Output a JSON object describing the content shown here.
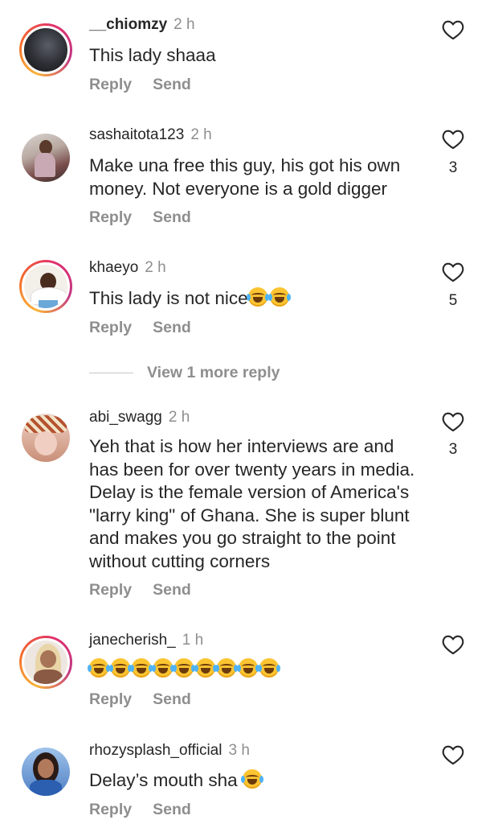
{
  "comments": [
    {
      "username": "__chiomzy",
      "time": "2 h",
      "text": "This lady shaaa",
      "likes": "",
      "reply": "Reply",
      "send": "Send",
      "avatar": "dark-photo-avatar"
    },
    {
      "username": "sashaitota123",
      "time": "2 h",
      "text": "Make una free this guy, his got his own money. Not everyone is a gold digger",
      "likes": "3",
      "reply": "Reply",
      "send": "Send",
      "avatar": "woman-photo-avatar"
    },
    {
      "username": "khaeyo",
      "time": "2 h",
      "text": "This lady is not nice",
      "emojis": 2,
      "likes": "5",
      "reply": "Reply",
      "send": "Send",
      "avatar": "woman-white-top-avatar"
    },
    {
      "username": "abi_swagg",
      "time": "2 h",
      "text": "Yeh that is how her interviews are and has been for over twenty years in media. Delay is the female version of America's \"larry king\" of Ghana. She is super blunt and makes you go straight to the point without cutting corners",
      "likes": "3",
      "reply": "Reply",
      "send": "Send",
      "avatar": "woman-headwrap-avatar"
    },
    {
      "username": "janecherish_",
      "time": "1 h",
      "text": "",
      "emojis": 9,
      "likes": "",
      "reply": "Reply",
      "send": "Send",
      "avatar": "woman-blonde-avatar"
    },
    {
      "username": "rhozysplash_official",
      "time": "3 h",
      "text": "Delay’s mouth sha",
      "emojis": 1,
      "likes": "",
      "reply": "Reply",
      "send": "Send",
      "avatar": "woman-blue-avatar"
    }
  ],
  "view_more": "View 1 more reply",
  "emoji_name": "face-with-tears-of-joy"
}
